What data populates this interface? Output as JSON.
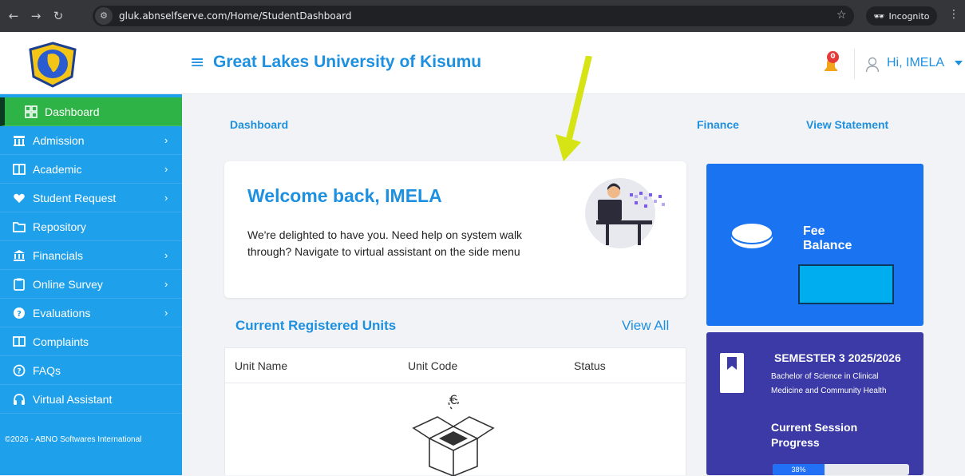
{
  "browser": {
    "url": "gluk.abnselfserve.com/Home/StudentDashboard",
    "incognito_label": "Incognito"
  },
  "header": {
    "title": "Great Lakes University of Kisumu",
    "notification_count": "0",
    "greeting": "Hi, IMELA"
  },
  "sidebar": {
    "items": [
      {
        "label": "Dashboard",
        "icon": "dashboard-icon"
      },
      {
        "label": "Admission",
        "icon": "building-icon"
      },
      {
        "label": "Academic",
        "icon": "book-open-icon"
      },
      {
        "label": "Student Request",
        "icon": "heart-hand-icon"
      },
      {
        "label": "Repository",
        "icon": "folder-icon"
      },
      {
        "label": "Financials",
        "icon": "bank-icon"
      },
      {
        "label": "Online Survey",
        "icon": "clipboard-icon"
      },
      {
        "label": "Evaluations",
        "icon": "question-icon"
      },
      {
        "label": "Complaints",
        "icon": "message-icon"
      },
      {
        "label": "FAQs",
        "icon": "faq-icon"
      },
      {
        "label": "Virtual Assistant",
        "icon": "headset-icon"
      }
    ],
    "copyright": "©2026 - ABNO Softwares International"
  },
  "breadcrumbs": {
    "left": "Dashboard",
    "middle": "Finance",
    "right": "View Statement"
  },
  "welcome": {
    "title": "Welcome back, IMELA",
    "text": "We're delighted to have you. Need help on system walk through? Navigate to virtual assistant on the side menu"
  },
  "units": {
    "title": "Current Registered Units",
    "view_all": "View All",
    "columns": [
      "Unit Name",
      "Unit Code",
      "Status"
    ]
  },
  "fee": {
    "label_line1": "Fee",
    "label_line2": "Balance"
  },
  "semester": {
    "title": "SEMESTER 3 2025/2026",
    "programme": "Bachelor of Science in Clinical Medicine and Community Health",
    "session_label": "Current Session Progress",
    "progress_percent": 38,
    "progress_label": "38%"
  },
  "colors": {
    "brand_blue": "#1e90e0",
    "sidebar_blue": "#1fa0ea",
    "active_green": "#2eb347",
    "fee_blue": "#1a73f0",
    "semester_purple": "#3b3aa7",
    "annotation_arrow": "#d6e314"
  }
}
